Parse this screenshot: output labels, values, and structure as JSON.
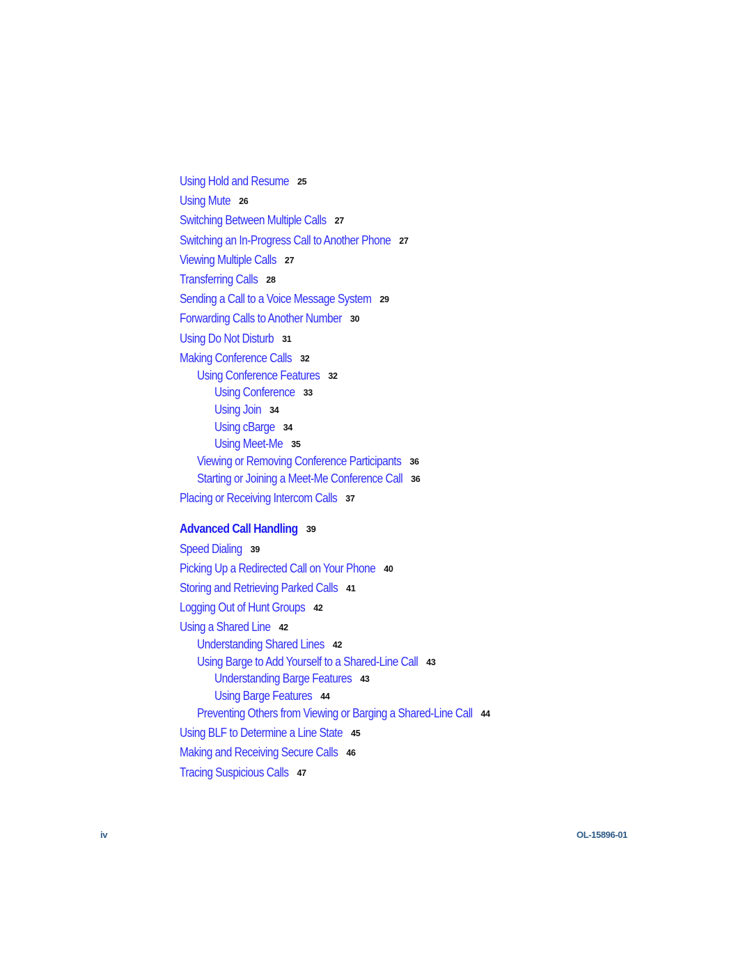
{
  "colors": {
    "link": "#2b2bf5",
    "page_number": "#111111",
    "footer": "#2e5a85"
  },
  "toc": {
    "entries": [
      {
        "title": "Using Hold and Resume",
        "page": "25",
        "level": 1
      },
      {
        "title": "Using Mute",
        "page": "26",
        "level": 1
      },
      {
        "title": "Switching Between Multiple Calls",
        "page": "27",
        "level": 1
      },
      {
        "title": "Switching an In-Progress Call to Another Phone",
        "page": "27",
        "level": 1
      },
      {
        "title": "Viewing Multiple Calls",
        "page": "27",
        "level": 1
      },
      {
        "title": "Transferring Calls",
        "page": "28",
        "level": 1
      },
      {
        "title": "Sending a Call to a Voice Message System",
        "page": "29",
        "level": 1
      },
      {
        "title": "Forwarding Calls to Another Number",
        "page": "30",
        "level": 1
      },
      {
        "title": "Using Do Not Disturb",
        "page": "31",
        "level": 1
      },
      {
        "title": "Making Conference Calls",
        "page": "32",
        "level": 1
      },
      {
        "title": "Using Conference Features",
        "page": "32",
        "level": 2
      },
      {
        "title": "Using Conference",
        "page": "33",
        "level": 3
      },
      {
        "title": "Using Join",
        "page": "34",
        "level": 3
      },
      {
        "title": "Using cBarge",
        "page": "34",
        "level": 3
      },
      {
        "title": "Using Meet-Me",
        "page": "35",
        "level": 3
      },
      {
        "title": "Viewing or Removing Conference Participants",
        "page": "36",
        "level": 2
      },
      {
        "title": "Starting or Joining a Meet-Me Conference Call",
        "page": "36",
        "level": 2
      },
      {
        "title": "Placing or Receiving Intercom Calls",
        "page": "37",
        "level": 1
      },
      {
        "title": "Advanced Call Handling",
        "page": "39",
        "level": 0
      },
      {
        "title": "Speed Dialing",
        "page": "39",
        "level": 1
      },
      {
        "title": "Picking Up a Redirected Call on Your Phone",
        "page": "40",
        "level": 1
      },
      {
        "title": "Storing and Retrieving Parked Calls",
        "page": "41",
        "level": 1
      },
      {
        "title": "Logging Out of Hunt Groups",
        "page": "42",
        "level": 1
      },
      {
        "title": "Using a Shared Line",
        "page": "42",
        "level": 1
      },
      {
        "title": "Understanding Shared Lines",
        "page": "42",
        "level": 2
      },
      {
        "title": "Using Barge to Add Yourself to a Shared-Line Call",
        "page": "43",
        "level": 2
      },
      {
        "title": "Understanding Barge Features",
        "page": "43",
        "level": 3
      },
      {
        "title": "Using Barge Features",
        "page": "44",
        "level": 3
      },
      {
        "title": "Preventing Others from Viewing or Barging a Shared-Line Call",
        "page": "44",
        "level": 2
      },
      {
        "title": "Using BLF to Determine a Line State",
        "page": "45",
        "level": 1
      },
      {
        "title": "Making and Receiving Secure Calls",
        "page": "46",
        "level": 1
      },
      {
        "title": "Tracing Suspicious Calls",
        "page": "47",
        "level": 1
      }
    ]
  },
  "footer": {
    "page_label": "iv",
    "doc_number": "OL-15896-01"
  }
}
